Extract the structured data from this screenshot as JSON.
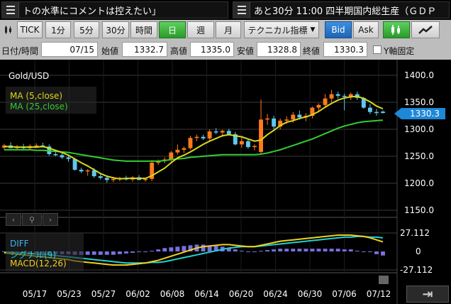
{
  "ticker": [
    {
      "text": "トの水準にコメントは控えたい」"
    },
    {
      "text": "あと30分 11:00 四半期国内総生産（ＧＤＰ"
    }
  ],
  "toolbar": {
    "intervals": [
      "TICK",
      "1分",
      "5分",
      "30分",
      "時間",
      "日",
      "週",
      "月"
    ],
    "active_interval": "日",
    "technical_label": "テクニカル指標",
    "bid_label": "Bid",
    "ask_label": "Ask"
  },
  "info": {
    "date_label": "日付/時間",
    "date_value": "07/15",
    "open_label": "始値",
    "open_value": "1332.7",
    "high_label": "高値",
    "high_value": "1335.0",
    "low_label": "安値",
    "low_value": "1328.8",
    "close_label": "終値",
    "close_value": "1330.3",
    "yfix_label": "Y軸固定"
  },
  "chart": {
    "symbol": "Gold/USD",
    "ma5_label": "MA (5,close)",
    "ma25_label": "MA (25,close)",
    "current_price": "1330.3",
    "macd_diff_label": "DIFF",
    "macd_signal_label": "シグナル(9)",
    "macd_label": "MACD(12,26)",
    "macd_ticks": [
      "27.112",
      "0",
      "-27.112"
    ],
    "dates": [
      "05/17",
      "05/23",
      "05/27",
      "06/02",
      "06/08",
      "06/14",
      "06/20",
      "06/24",
      "06/30",
      "07/06",
      "07/12"
    ],
    "colors": {
      "up": "#ff7a1a",
      "down": "#5fc8f0",
      "ma5": "#d8d820",
      "ma25": "#33cc33",
      "macd": "#f0d020",
      "signal": "#22d0d0",
      "hist": "#7a70e0",
      "price_tag": "#1e88d8"
    }
  },
  "chart_data": {
    "type": "candlestick",
    "y_ticks": [
      1400,
      1350,
      1300,
      1250,
      1200,
      1150
    ],
    "ylim": [
      1150,
      1400
    ],
    "candles": [
      {
        "o": 1266,
        "h": 1273,
        "l": 1262,
        "c": 1270
      },
      {
        "o": 1270,
        "h": 1276,
        "l": 1266,
        "c": 1265
      },
      {
        "o": 1265,
        "h": 1271,
        "l": 1262,
        "c": 1268
      },
      {
        "o": 1268,
        "h": 1273,
        "l": 1263,
        "c": 1265
      },
      {
        "o": 1265,
        "h": 1272,
        "l": 1262,
        "c": 1269
      },
      {
        "o": 1269,
        "h": 1274,
        "l": 1265,
        "c": 1270
      },
      {
        "o": 1270,
        "h": 1275,
        "l": 1266,
        "c": 1268
      },
      {
        "o": 1268,
        "h": 1272,
        "l": 1251,
        "c": 1254
      },
      {
        "o": 1254,
        "h": 1260,
        "l": 1250,
        "c": 1252
      },
      {
        "o": 1252,
        "h": 1257,
        "l": 1245,
        "c": 1248
      },
      {
        "o": 1248,
        "h": 1252,
        "l": 1240,
        "c": 1245
      },
      {
        "o": 1245,
        "h": 1247,
        "l": 1223,
        "c": 1225
      },
      {
        "o": 1225,
        "h": 1229,
        "l": 1219,
        "c": 1222
      },
      {
        "o": 1222,
        "h": 1226,
        "l": 1214,
        "c": 1224
      },
      {
        "o": 1224,
        "h": 1228,
        "l": 1210,
        "c": 1213
      },
      {
        "o": 1213,
        "h": 1217,
        "l": 1207,
        "c": 1210
      },
      {
        "o": 1210,
        "h": 1214,
        "l": 1201,
        "c": 1206
      },
      {
        "o": 1206,
        "h": 1212,
        "l": 1202,
        "c": 1208
      },
      {
        "o": 1208,
        "h": 1212,
        "l": 1204,
        "c": 1210
      },
      {
        "o": 1210,
        "h": 1214,
        "l": 1205,
        "c": 1207
      },
      {
        "o": 1207,
        "h": 1213,
        "l": 1203,
        "c": 1211
      },
      {
        "o": 1211,
        "h": 1215,
        "l": 1206,
        "c": 1206
      },
      {
        "o": 1206,
        "h": 1210,
        "l": 1203,
        "c": 1208
      },
      {
        "o": 1208,
        "h": 1243,
        "l": 1204,
        "c": 1238
      },
      {
        "o": 1238,
        "h": 1244,
        "l": 1234,
        "c": 1242
      },
      {
        "o": 1242,
        "h": 1248,
        "l": 1237,
        "c": 1244
      },
      {
        "o": 1244,
        "h": 1260,
        "l": 1240,
        "c": 1257
      },
      {
        "o": 1257,
        "h": 1272,
        "l": 1253,
        "c": 1262
      },
      {
        "o": 1262,
        "h": 1268,
        "l": 1256,
        "c": 1265
      },
      {
        "o": 1265,
        "h": 1288,
        "l": 1262,
        "c": 1284
      },
      {
        "o": 1284,
        "h": 1290,
        "l": 1278,
        "c": 1286
      },
      {
        "o": 1286,
        "h": 1290,
        "l": 1280,
        "c": 1283
      },
      {
        "o": 1283,
        "h": 1300,
        "l": 1279,
        "c": 1296
      },
      {
        "o": 1296,
        "h": 1302,
        "l": 1291,
        "c": 1294
      },
      {
        "o": 1294,
        "h": 1299,
        "l": 1286,
        "c": 1297
      },
      {
        "o": 1297,
        "h": 1301,
        "l": 1289,
        "c": 1291
      },
      {
        "o": 1291,
        "h": 1295,
        "l": 1270,
        "c": 1272
      },
      {
        "o": 1272,
        "h": 1285,
        "l": 1266,
        "c": 1278
      },
      {
        "o": 1278,
        "h": 1282,
        "l": 1264,
        "c": 1267
      },
      {
        "o": 1267,
        "h": 1272,
        "l": 1261,
        "c": 1269
      },
      {
        "o": 1258,
        "h": 1355,
        "l": 1255,
        "c": 1318
      },
      {
        "o": 1318,
        "h": 1328,
        "l": 1308,
        "c": 1320
      },
      {
        "o": 1320,
        "h": 1325,
        "l": 1300,
        "c": 1305
      },
      {
        "o": 1305,
        "h": 1320,
        "l": 1300,
        "c": 1316
      },
      {
        "o": 1316,
        "h": 1324,
        "l": 1310,
        "c": 1318
      },
      {
        "o": 1318,
        "h": 1332,
        "l": 1312,
        "c": 1327
      },
      {
        "o": 1327,
        "h": 1335,
        "l": 1318,
        "c": 1322
      },
      {
        "o": 1322,
        "h": 1330,
        "l": 1315,
        "c": 1325
      },
      {
        "o": 1325,
        "h": 1342,
        "l": 1320,
        "c": 1340
      },
      {
        "o": 1340,
        "h": 1348,
        "l": 1334,
        "c": 1345
      },
      {
        "o": 1345,
        "h": 1365,
        "l": 1340,
        "c": 1357
      },
      {
        "o": 1357,
        "h": 1373,
        "l": 1350,
        "c": 1365
      },
      {
        "o": 1365,
        "h": 1370,
        "l": 1357,
        "c": 1362
      },
      {
        "o": 1362,
        "h": 1366,
        "l": 1335,
        "c": 1360
      },
      {
        "o": 1360,
        "h": 1368,
        "l": 1354,
        "c": 1365
      },
      {
        "o": 1365,
        "h": 1370,
        "l": 1354,
        "c": 1358
      },
      {
        "o": 1358,
        "h": 1360,
        "l": 1338,
        "c": 1340
      },
      {
        "o": 1340,
        "h": 1347,
        "l": 1328,
        "c": 1332
      },
      {
        "o": 1332,
        "h": 1338,
        "l": 1325,
        "c": 1330
      },
      {
        "o": 1332.7,
        "h": 1335.0,
        "l": 1328.8,
        "c": 1330.3
      }
    ],
    "ma5": [
      1268,
      1268,
      1267,
      1267,
      1267,
      1267,
      1268,
      1265,
      1261,
      1257,
      1252,
      1245,
      1238,
      1232,
      1225,
      1218,
      1213,
      1210,
      1208,
      1209,
      1209,
      1209,
      1209,
      1214,
      1221,
      1228,
      1238,
      1247,
      1252,
      1258,
      1265,
      1272,
      1278,
      1283,
      1288,
      1290,
      1288,
      1286,
      1282,
      1278,
      1280,
      1290,
      1298,
      1307,
      1313,
      1316,
      1320,
      1323,
      1327,
      1333,
      1341,
      1348,
      1354,
      1358,
      1360,
      1361,
      1357,
      1351,
      1343,
      1338
    ],
    "ma25": [
      1262,
      1262,
      1262,
      1262,
      1262,
      1261,
      1261,
      1260,
      1259,
      1258,
      1257,
      1255,
      1253,
      1251,
      1249,
      1247,
      1245,
      1243,
      1242,
      1241,
      1241,
      1241,
      1241,
      1241,
      1241,
      1242,
      1244,
      1245,
      1246,
      1248,
      1249,
      1250,
      1251,
      1252,
      1253,
      1253,
      1253,
      1253,
      1253,
      1253,
      1254,
      1256,
      1259,
      1262,
      1266,
      1270,
      1274,
      1278,
      1282,
      1287,
      1292,
      1297,
      1302,
      1306,
      1309,
      1312,
      1314,
      1315,
      1316,
      1317
    ],
    "macd": {
      "ylim": [
        -27.112,
        27.112
      ],
      "diff": [
        -2,
        -3,
        -4,
        -5,
        -6,
        -7,
        -8,
        -9,
        -10,
        -11,
        -12,
        -14,
        -15,
        -16,
        -17,
        -18,
        -19,
        -20,
        -20,
        -20,
        -19,
        -18,
        -17,
        -15,
        -13,
        -10,
        -7,
        -4,
        -1,
        2,
        5,
        7,
        8,
        9,
        10,
        10,
        9,
        8,
        7,
        7,
        9,
        11,
        13,
        15,
        16,
        17,
        18,
        19,
        20,
        21,
        22,
        23,
        24,
        24,
        24,
        23,
        22,
        20,
        17,
        14
      ],
      "signal": [
        -1,
        -1,
        -2,
        -2,
        -3,
        -4,
        -4,
        -5,
        -6,
        -7,
        -8,
        -9,
        -10,
        -11,
        -12,
        -13,
        -14,
        -15,
        -16,
        -17,
        -17,
        -17,
        -17,
        -16,
        -16,
        -15,
        -13,
        -11,
        -9,
        -7,
        -5,
        -3,
        -1,
        1,
        3,
        5,
        6,
        7,
        7,
        7,
        8,
        9,
        10,
        11,
        12,
        13,
        14,
        15,
        16,
        17,
        18,
        19,
        20,
        21,
        21,
        22,
        22,
        21,
        21,
        20
      ],
      "hist": [
        -1,
        -2,
        -2,
        -3,
        -3,
        -3,
        -4,
        -4,
        -4,
        -4,
        -4,
        -5,
        -5,
        -5,
        -5,
        -5,
        -5,
        -5,
        -4,
        -3,
        -2,
        -1,
        0,
        1,
        3,
        5,
        6,
        7,
        8,
        9,
        10,
        10,
        9,
        8,
        7,
        5,
        3,
        1,
        0,
        0,
        1,
        2,
        3,
        4,
        4,
        4,
        4,
        4,
        4,
        4,
        4,
        4,
        4,
        3,
        3,
        1,
        0,
        -1,
        -4,
        -6
      ]
    }
  }
}
